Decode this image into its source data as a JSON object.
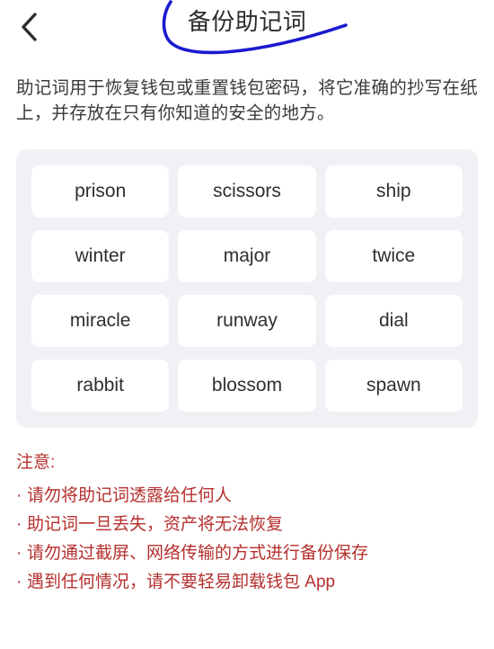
{
  "header": {
    "back_icon": "chevron-left-icon",
    "title": "备份助记词",
    "annotation_color": "#1a1ad0"
  },
  "description": "助记词用于恢复钱包或重置钱包密码，将它准确的抄写在纸上，并存放在只有你知道的安全的地方。",
  "mnemonic": {
    "words": [
      "prison",
      "scissors",
      "ship",
      "winter",
      "major",
      "twice",
      "miracle",
      "runway",
      "dial",
      "rabbit",
      "blossom",
      "spawn"
    ]
  },
  "warning": {
    "title": "注意:",
    "bullet": "·",
    "color": "#b5302e",
    "items": [
      "请勿将助记词透露给任何人",
      "助记词一旦丢失，资产将无法恢复",
      "请勿通过截屏、网络传输的方式进行备份保存",
      "遇到任何情况，请不要轻易卸载钱包 App"
    ]
  }
}
